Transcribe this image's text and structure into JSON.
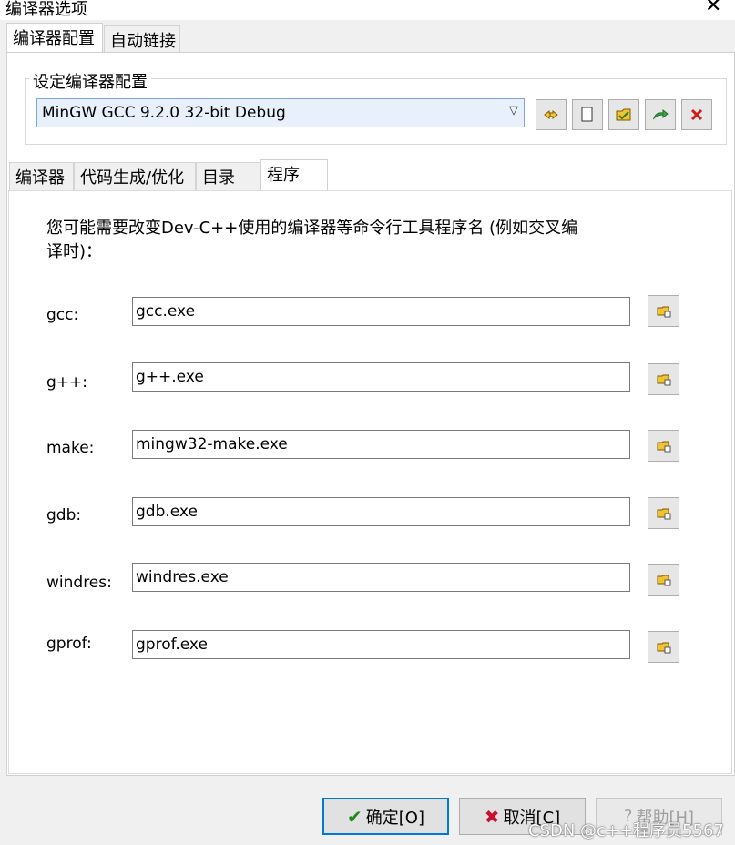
{
  "window": {
    "title": "编译器选项",
    "close_glyph": "✕"
  },
  "top_tabs": [
    {
      "label": "编译器配置",
      "active": true
    },
    {
      "label": "自动链接",
      "active": false
    }
  ],
  "config_group": {
    "legend": "设定编译器配置",
    "selected": "MinGW GCC 9.2.0 32-bit Debug",
    "toolbar_icons": [
      "rename-icon",
      "blank-icon",
      "folder-check-icon",
      "export-icon",
      "delete-icon"
    ]
  },
  "inner_tabs": [
    {
      "label": "编译器",
      "active": false
    },
    {
      "label": "代码生成/优化",
      "active": false
    },
    {
      "label": "目录",
      "active": false
    },
    {
      "label": "程序",
      "active": true
    }
  ],
  "programs": {
    "description": "您可能需要改变Dev-C++使用的编译器等命令行工具程序名 (例如交叉编译时)：",
    "description_line1": "您可能需要改变Dev-C++使用的编译器等命令行工具程序名 (例如交叉编",
    "description_line2": "译时)：",
    "rows": [
      {
        "label": "gcc:",
        "value": "gcc.exe"
      },
      {
        "label": "g++:",
        "value": "g++.exe"
      },
      {
        "label": "make:",
        "value": "mingw32-make.exe"
      },
      {
        "label": "gdb:",
        "value": "gdb.exe"
      },
      {
        "label": "windres:",
        "value": "windres.exe"
      },
      {
        "label": "gprof:",
        "value": "gprof.exe"
      }
    ]
  },
  "buttons": {
    "ok": "确定[O]",
    "cancel": "取消[C]",
    "help": "帮助[H]"
  },
  "watermark": "CSDN @c++程序员5567",
  "colors": {
    "accent": "#0078d7",
    "ok_check": "#1e8a1e",
    "cancel_x": "#c8102e"
  }
}
